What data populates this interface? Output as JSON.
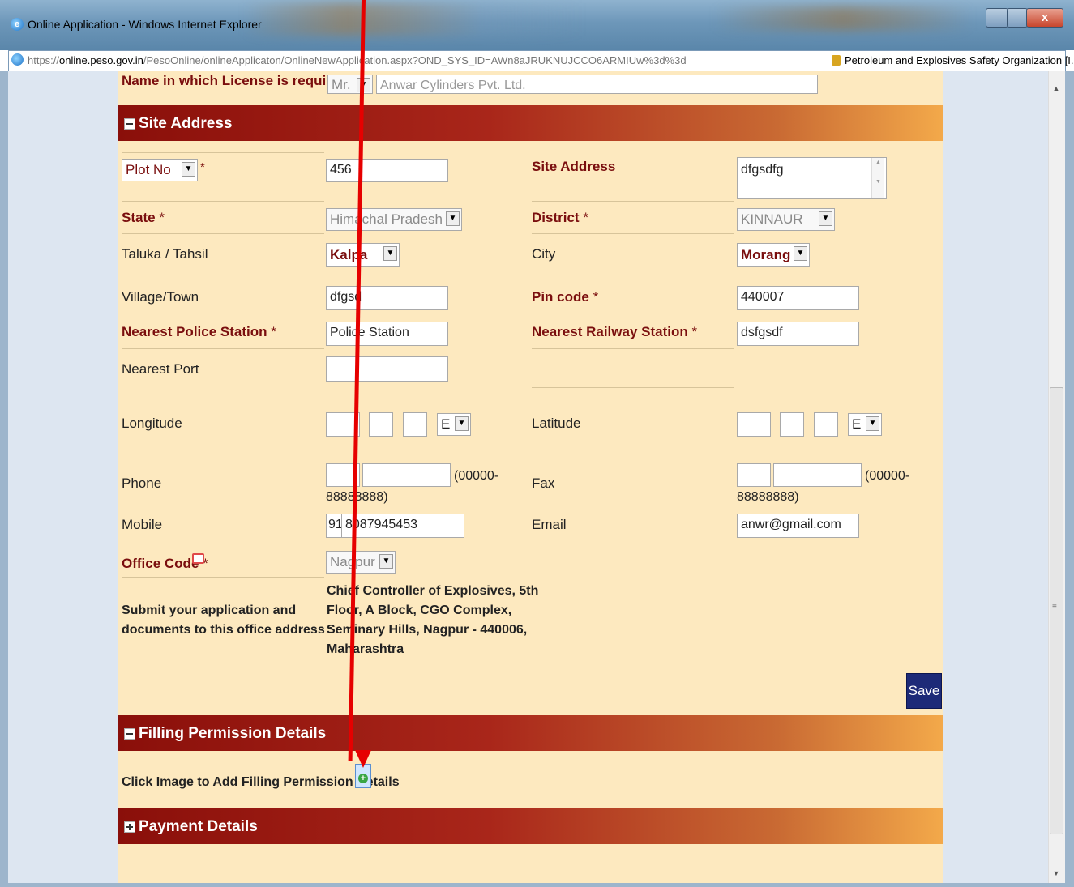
{
  "window": {
    "title": "Online Application - Windows Internet Explorer",
    "url_prefix": "https://",
    "url_host": "online.peso.gov.in",
    "url_rest": "/PesoOnline/onlineApplicaton/OnlineNewApplication.aspx?OND_SYS_ID=AWn8aJRUKNUJCCO6ARMIUw%3d%3d",
    "site_identity": "Petroleum and Explosives Safety Organization [I...",
    "close_label": "x"
  },
  "top_row": {
    "label": "Name in which License is required",
    "star": "*",
    "salutation": "Mr.",
    "name_value": "Anwar Cylinders Pvt. Ltd."
  },
  "sections": {
    "site_address": "Site Address",
    "filling": "Filling Permission Details",
    "payment": "Payment Details"
  },
  "form": {
    "plot_no": {
      "select": "Plot No",
      "star": "*",
      "value": "456"
    },
    "site_address": {
      "label": "Site Address",
      "value": "dfgsdfg"
    },
    "state": {
      "label": "State",
      "star": "*",
      "value": "Himachal Pradesh"
    },
    "district": {
      "label": "District",
      "star": "*",
      "value": "KINNAUR"
    },
    "taluka": {
      "label": "Taluka / Tahsil",
      "value": "Kalpa"
    },
    "city": {
      "label": "City",
      "value": "Morang"
    },
    "village": {
      "label": "Village/Town",
      "value": "dfgsd"
    },
    "pin": {
      "label": "Pin code",
      "star": "*",
      "value": "440007"
    },
    "police": {
      "label": "Nearest Police Station",
      "star": "*",
      "value": "Police Station"
    },
    "railway": {
      "label": "Nearest Railway Station",
      "star": "*",
      "value": "dsfgsdf"
    },
    "port": {
      "label": "Nearest Port",
      "value": ""
    },
    "longitude": {
      "label": "Longitude",
      "dir": "E"
    },
    "latitude": {
      "label": "Latitude",
      "dir": "E"
    },
    "phone": {
      "label": "Phone",
      "hint_a": "(00000-",
      "hint_b": "88888888)"
    },
    "fax": {
      "label": "Fax",
      "hint_a": "(00000-",
      "hint_b": "88888888)"
    },
    "mobile": {
      "label": "Mobile",
      "prefix": "91",
      "value": "8087945453"
    },
    "email": {
      "label": "Email",
      "value": "anwr@gmail.com"
    },
    "office": {
      "label": "Office Code",
      "star": "*",
      "value": "Nagpur"
    },
    "submit_note": {
      "line1": "Submit your application and",
      "line2": "documents to this office address :"
    },
    "office_address": {
      "line1": "Chief Controller of Explosives, 5th",
      "line2": "Floor, A Block, CGO Complex,",
      "line3": "Seminary Hills, Nagpur - 440006,",
      "line4": "Maharashtra"
    },
    "save": "Save"
  },
  "filling": {
    "note": "Click Image to Add Filling Permission Details"
  },
  "colors": {
    "accent": "#8a0f0a",
    "panel": "#fde9bf",
    "arrow": "#e60000",
    "save": "#1d2a78"
  }
}
